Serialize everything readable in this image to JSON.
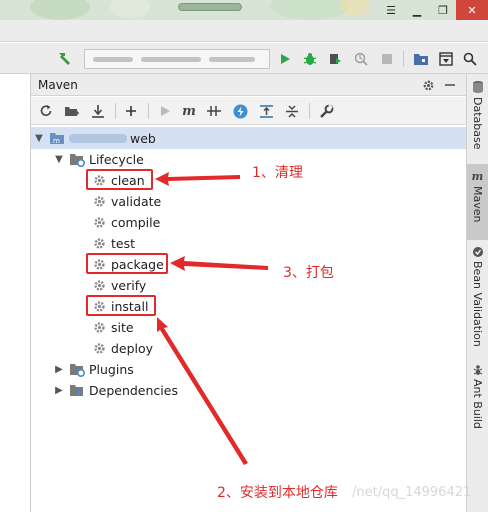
{
  "panel": {
    "title": "Maven",
    "project_suffix": "web",
    "lifecycle_label": "Lifecycle",
    "goals": [
      "clean",
      "validate",
      "compile",
      "test",
      "package",
      "verify",
      "install",
      "site",
      "deploy"
    ],
    "plugins_label": "Plugins",
    "dependencies_label": "Dependencies"
  },
  "stripe": {
    "tabs": [
      "Database",
      "Maven",
      "Bean Validation",
      "Ant Build"
    ],
    "active": "Maven"
  },
  "annotations": {
    "clean_note": "1、清理",
    "package_note": "3、打包",
    "install_note": "2、安装到本地仓库"
  },
  "watermark": "/net/qq_14996421",
  "colors": {
    "highlight": "#e22a2a",
    "selection": "#d5e1f2",
    "run_green": "#2aa843"
  },
  "icons": {
    "toolbar": [
      "refresh-icon",
      "add-project-icon",
      "download-icon",
      "plus-icon",
      "run-icon",
      "maven-goal-icon",
      "toggle-offline-icon",
      "skip-tests-icon",
      "show-dependencies-icon",
      "collapse-icon",
      "settings-wrench-icon"
    ],
    "goal": "gear-icon"
  }
}
